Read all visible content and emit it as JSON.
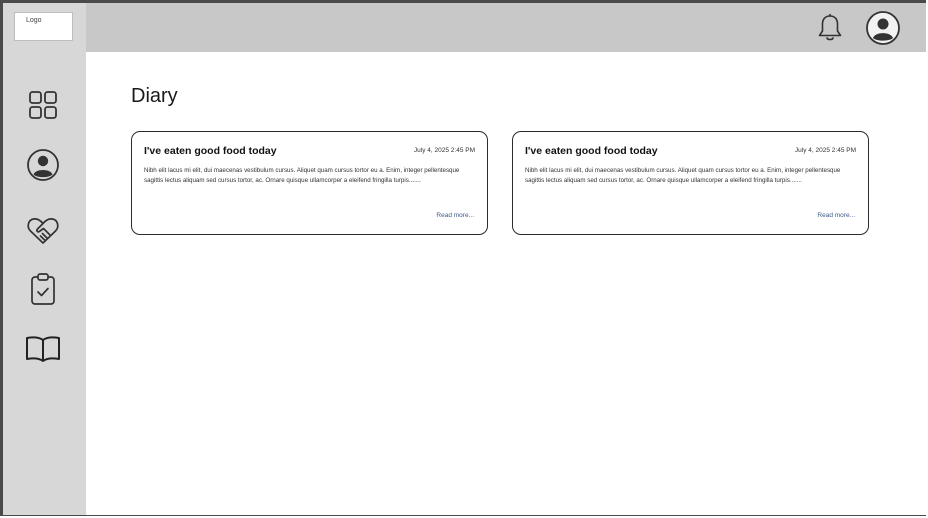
{
  "logo": {
    "text": "Logo"
  },
  "sidebar": {
    "items": [
      {
        "icon": "dashboard-grid-icon"
      },
      {
        "icon": "profile-icon"
      },
      {
        "icon": "heart-handshake-icon"
      },
      {
        "icon": "clipboard-check-icon"
      },
      {
        "icon": "book-icon"
      }
    ]
  },
  "header": {
    "icons": [
      "bell-icon",
      "user-avatar-icon"
    ]
  },
  "main": {
    "title": "Diary",
    "entries": [
      {
        "title": "I've eaten good food today",
        "date": "July 4, 2025 2:45 PM",
        "body": "Nibh elit lacus mi elit, dui maecenas vestibulum cursus. Aliquet quam cursus tortor eu a. Enim, integer pellentesque sagittis lectus aliquam sed cursus tortor, ac. Ornare quisque ullamcorper a eleifend fringilla turpis.......",
        "more": "Read more..."
      },
      {
        "title": "I've eaten good food today",
        "date": "July 4, 2025 2:45 PM",
        "body": "Nibh elit lacus mi elit, dui maecenas vestibulum cursus. Aliquet quam cursus tortor eu a. Enim, integer pellentesque sagittis lectus aliquam sed cursus tortor, ac. Ornare quisque ullamcorper a eleifend fringilla turpis.......",
        "more": "Read more..."
      }
    ]
  },
  "colors": {
    "sidebar_bg": "#d7d7d7",
    "topbar_bg": "#c8c8c8",
    "link": "#3c5a86"
  }
}
